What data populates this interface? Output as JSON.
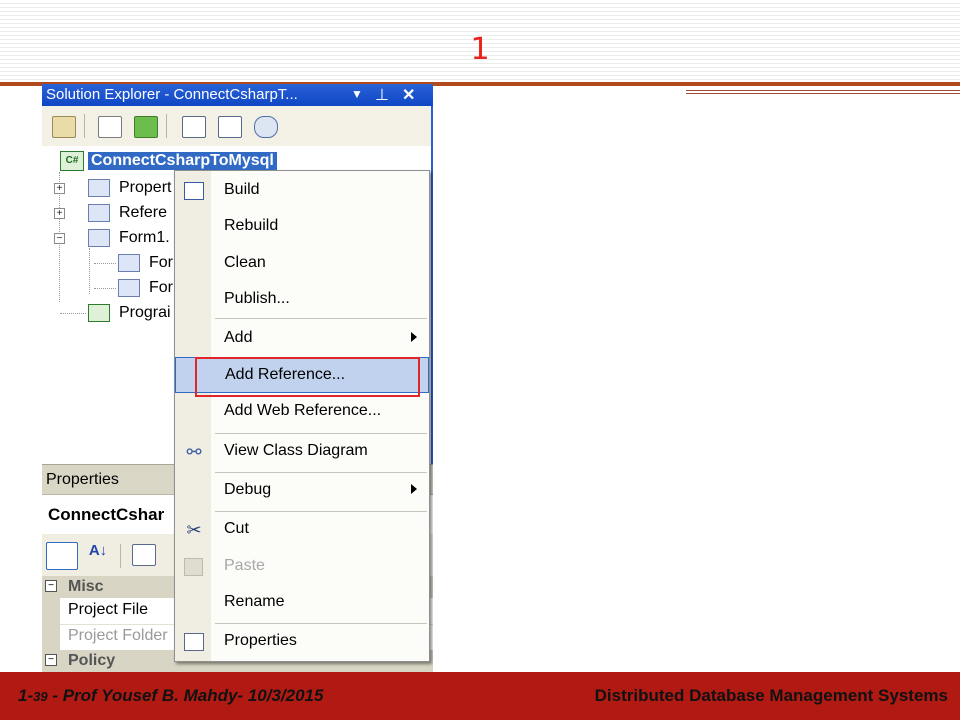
{
  "slide": {
    "title": "1",
    "footer_prefix": "1-",
    "footer_page": "39",
    "footer_author": " - Prof  Yousef  B. Mahdy- 10/3/2015",
    "footer_course": "Distributed Database Management Systems"
  },
  "solution_explorer": {
    "title": "Solution Explorer - ConnectCsharpT...",
    "root": "ConnectCsharpToMysql",
    "items": [
      "Propert",
      "Refere",
      "Form1.",
      "For",
      "For",
      "Prograi"
    ]
  },
  "properties": {
    "title": "Properties",
    "object": "ConnectCshar",
    "category": "Misc",
    "next_category": "Policy",
    "rows": [
      "Project File",
      "Project Folder"
    ]
  },
  "context_menu": {
    "items": [
      "Build",
      "Rebuild",
      "Clean",
      "Publish...",
      "Add",
      "Add Reference...",
      "Add Web Reference...",
      "View Class Diagram",
      "Debug",
      "Cut",
      "Paste",
      "Rename",
      "Properties"
    ],
    "highlighted": "Add Reference...",
    "disabled": [
      "Paste"
    ]
  },
  "colors": {
    "accent_title": "#e8231d",
    "footer_bg": "#b01a12",
    "selection": "#316ac5",
    "highlight_box": "#e0262a"
  }
}
